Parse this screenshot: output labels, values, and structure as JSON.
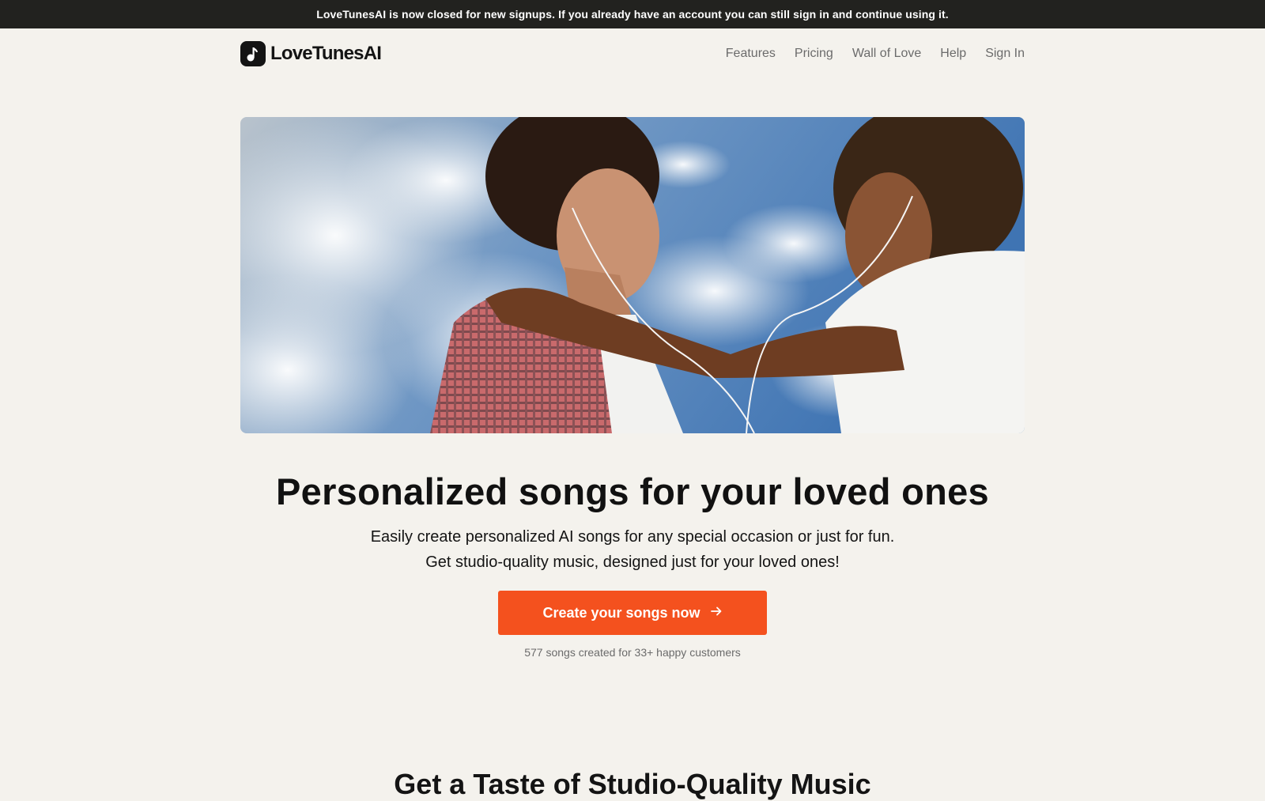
{
  "banner": {
    "text": "LoveTunesAI is now closed for new signups. If you already have an account you can still sign in and continue using it."
  },
  "brand": {
    "name": "LoveTunesAI",
    "logo_icon": "music-note-icon"
  },
  "nav": {
    "links": [
      "Features",
      "Pricing",
      "Wall of Love",
      "Help",
      "Sign In"
    ]
  },
  "hero": {
    "image_alt": "couple-sharing-earphones-photo",
    "headline": "Personalized songs for your loved ones",
    "subline_1": "Easily create personalized AI songs for any special occasion or just for fun.",
    "subline_2": "Get studio-quality music, designed just for your loved ones!",
    "cta_label": "Create your songs now",
    "cta_icon": "arrow-right-icon",
    "stats": "577 songs created for 33+ happy customers"
  },
  "next_section": {
    "title": "Get a Taste of Studio-Quality Music"
  },
  "colors": {
    "accent": "#f4511e",
    "banner_bg": "#22221f",
    "page_bg": "#f4f2ed"
  }
}
